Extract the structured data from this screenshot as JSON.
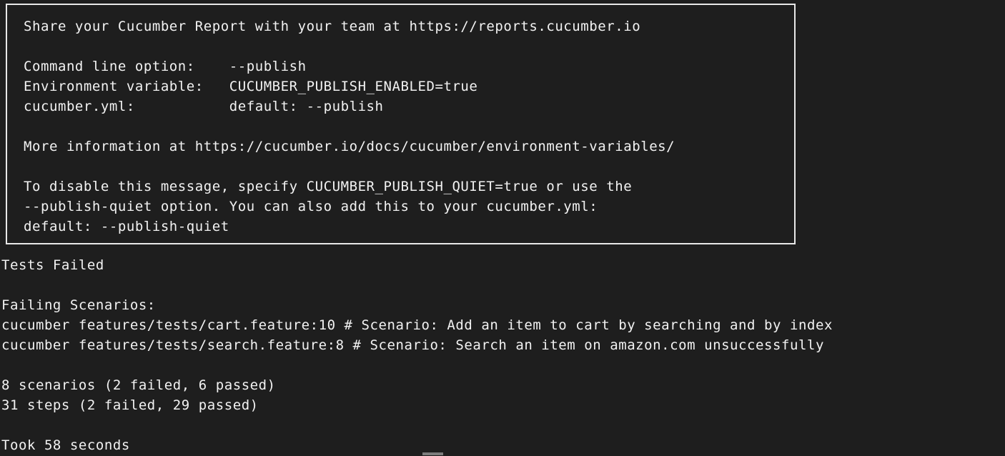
{
  "terminal": {
    "background_color": "#1e1e1e",
    "text_color": "#f2f2f2",
    "border_color": "#e8e8e8"
  },
  "banner": {
    "lines": [
      "Share your Cucumber Report with your team at https://reports.cucumber.io",
      "",
      "Command line option:    --publish",
      "Environment variable:   CUCUMBER_PUBLISH_ENABLED=true",
      "cucumber.yml:           default: --publish",
      "",
      "More information at https://cucumber.io/docs/cucumber/environment-variables/",
      "",
      "To disable this message, specify CUCUMBER_PUBLISH_QUIET=true or use the",
      "--publish-quiet option. You can also add this to your cucumber.yml:",
      "default: --publish-quiet"
    ],
    "heading": "Share your Cucumber Report with your team at https://reports.cucumber.io",
    "report_url": "https://reports.cucumber.io",
    "docs_url": "https://cucumber.io/docs/cucumber/environment-variables/",
    "options": [
      {
        "label": "Command line option:",
        "value": "--publish"
      },
      {
        "label": "Environment variable:",
        "value": "CUCUMBER_PUBLISH_ENABLED=true"
      },
      {
        "label": "cucumber.yml:",
        "value": "default: --publish"
      }
    ]
  },
  "results": {
    "status": "Tests Failed",
    "failing_header": "Failing Scenarios:",
    "failing_scenarios": [
      "cucumber features/tests/cart.feature:10 # Scenario: Add an item to cart by searching and by index",
      "cucumber features/tests/search.feature:8 # Scenario: Search an item on amazon.com unsuccessfully"
    ],
    "scenario_summary": "8 scenarios (2 failed, 6 passed)",
    "step_summary": "31 steps (2 failed, 29 passed)",
    "duration": "Took 58 seconds",
    "counts": {
      "scenarios_total": 8,
      "scenarios_failed": 2,
      "scenarios_passed": 6,
      "steps_total": 31,
      "steps_failed": 2,
      "steps_passed": 29,
      "duration_seconds": 58
    }
  }
}
